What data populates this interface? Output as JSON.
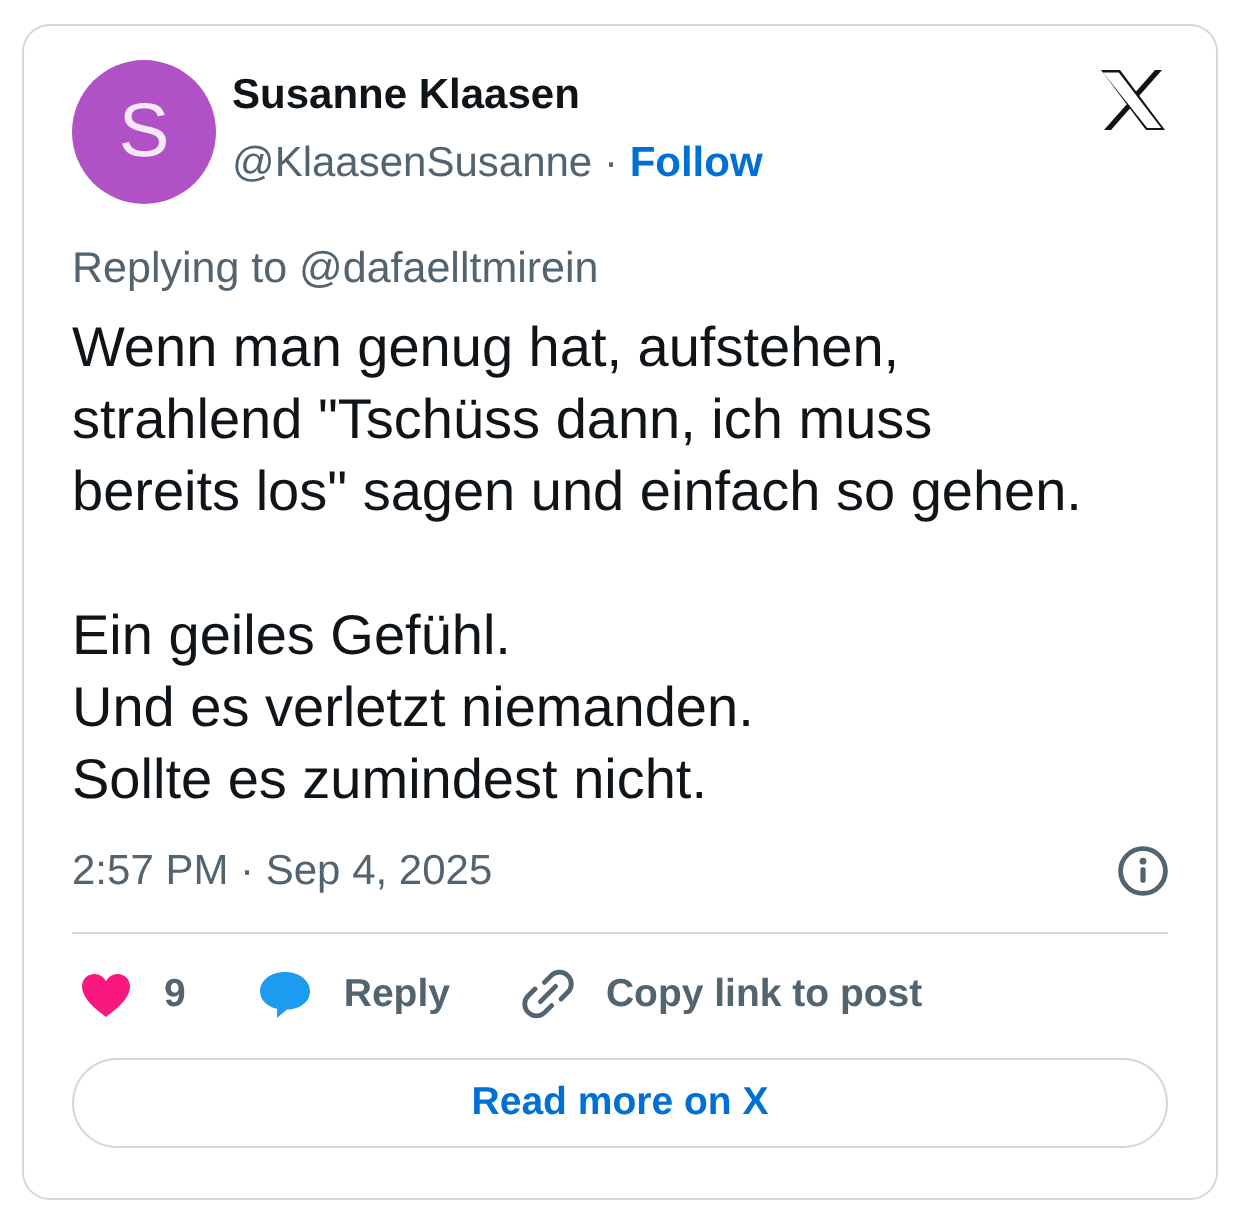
{
  "author": {
    "avatar_letter": "S",
    "name": "Susanne Klaasen",
    "handle": "@KlaasenSusanne",
    "separator": "·",
    "follow": "Follow"
  },
  "reply_to": "Replying to @dafaelltmirein",
  "body": [
    "Wenn man genug hat, aufstehen, strahlend \"Tschüss dann, ich muss bereits los\" sagen und einfach so gehen.",
    "Ein geiles Gefühl.\nUnd es verletzt niemanden.\nSollte es zumindest nicht."
  ],
  "timestamp": "2:57 PM · Sep 4, 2025",
  "actions": [
    {
      "kind": "like",
      "label": "9"
    },
    {
      "kind": "reply",
      "label": "Reply"
    },
    {
      "kind": "copy_link",
      "label": "Copy link to post"
    }
  ],
  "read_more": "Read more on X"
}
